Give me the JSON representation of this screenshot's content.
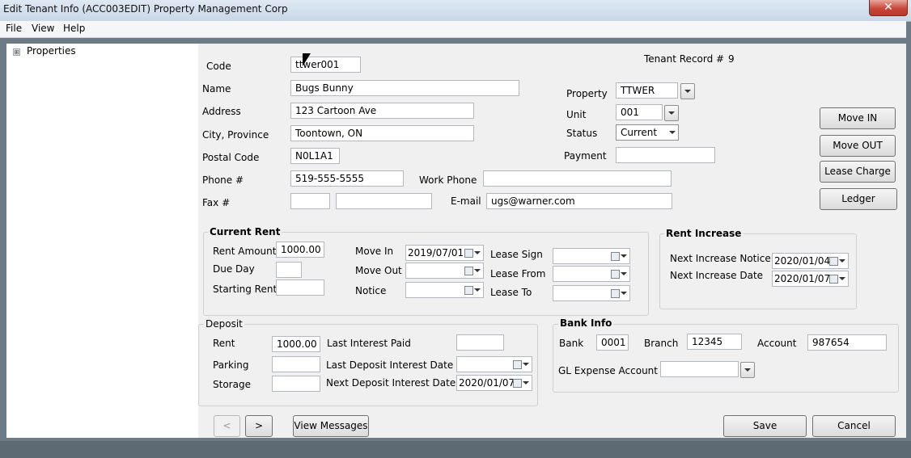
{
  "window": {
    "title": "Edit Tenant Info (ACC003EDIT)  Property Management Corp",
    "close_glyph": "✕"
  },
  "menu": [
    "File",
    "View",
    "Help"
  ],
  "sidebar": {
    "expander": "⊞",
    "tree_root": "Properties"
  },
  "tenant": {
    "code_label": "Code",
    "code": "ttwer001",
    "name_label": "Name",
    "name": "Bugs Bunny",
    "address_label": "Address",
    "address": "123 Cartoon Ave",
    "city_label": "City, Province",
    "city": "Toontown,  ON",
    "postal_label": "Postal Code",
    "postal": "N0L1A1",
    "phone_label": "Phone #",
    "phone": "519-555-5555",
    "work_phone_label": "Work Phone",
    "work_phone": "",
    "fax_label": "Fax #",
    "fax_area": "",
    "fax": "",
    "email_label": "E-mail",
    "email": "ugs@warner.com",
    "record_label": "Tenant Record #",
    "record_no": "9",
    "property_label": "Property",
    "property": "TTWER",
    "unit_label": "Unit",
    "unit": "001",
    "status_label": "Status",
    "status": "Current",
    "payment_label": "Payment",
    "payment": ""
  },
  "actions": {
    "move_in": "Move IN",
    "move_out": "Move OUT",
    "lease_charge": "Lease Charge",
    "ledger": "Ledger"
  },
  "current_rent": {
    "title": "Current Rent",
    "rent_amount_label": "Rent Amount",
    "rent_amount": "1000.00",
    "due_day_label": "Due Day",
    "due_day": "",
    "starting_rent_label": "Starting Rent",
    "starting_rent": "",
    "move_in_label": "Move In",
    "move_in": "2019/07/01",
    "move_out_label": "Move Out",
    "move_out": "",
    "notice_label": "Notice",
    "notice": "",
    "lease_sign_label": "Lease Sign",
    "lease_sign": "",
    "lease_from_label": "Lease From",
    "lease_from": "",
    "lease_to_label": "Lease To",
    "lease_to": ""
  },
  "rent_increase": {
    "title": "Rent Increase",
    "notice_label": "Next Increase Notice",
    "notice": "2020/01/04",
    "date_label": "Next Increase Date",
    "date": "2020/01/07"
  },
  "deposit": {
    "title": "Deposit",
    "rent_label": "Rent",
    "rent": "1000.00",
    "parking_label": "Parking",
    "parking": "",
    "storage_label": "Storage",
    "storage": "",
    "last_interest_label": "Last Interest Paid",
    "last_interest": "",
    "last_dep_label": "Last Deposit Interest Date",
    "last_dep": "",
    "next_dep_label": "Next Deposit Interest Date",
    "next_dep": "2020/01/07"
  },
  "bank": {
    "title": "Bank Info",
    "bank_label": "Bank",
    "bank": "0001",
    "branch_label": "Branch",
    "branch": "12345",
    "account_label": "Account",
    "account": "987654",
    "gl_label": "GL Expense Account",
    "gl": ""
  },
  "footer": {
    "prev": "<",
    "next": ">",
    "view_messages": "View Messages",
    "save": "Save",
    "cancel": "Cancel"
  }
}
